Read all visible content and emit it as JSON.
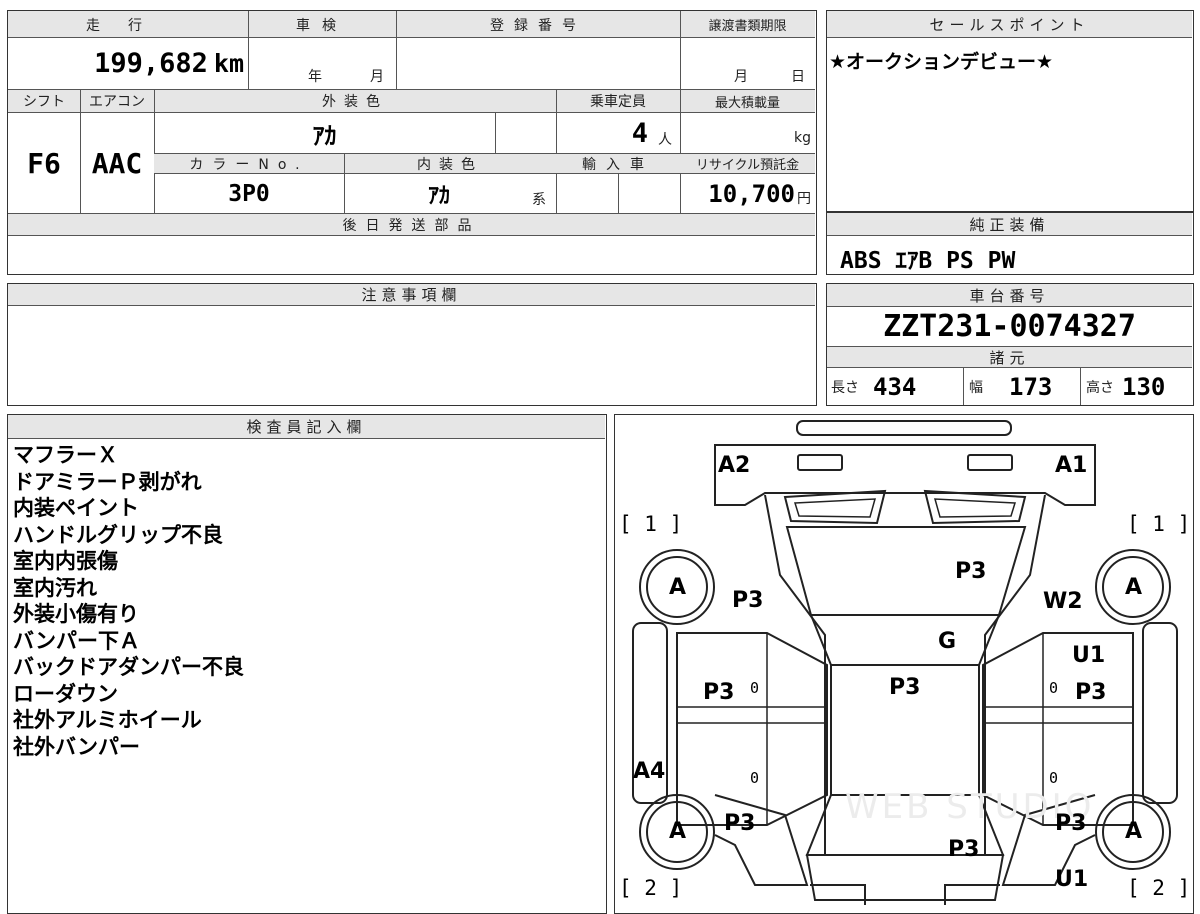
{
  "top_form": {
    "mileage": {
      "label": "走行",
      "value": "199,682",
      "unit": "km"
    },
    "shaken": {
      "label": "車検",
      "year_unit": "年",
      "month_unit": "月"
    },
    "registration_number": {
      "label": "登録番号",
      "value": ""
    },
    "transfer_deadline": {
      "label": "譲渡書類期限",
      "month_unit": "月",
      "day_unit": "日"
    },
    "shift": {
      "label": "シフト",
      "value": "F6"
    },
    "aircon": {
      "label": "エアコン",
      "value": "AAC"
    },
    "exterior_color": {
      "label": "外装色",
      "value": "ｱｶ"
    },
    "capacity": {
      "label": "乗車定員",
      "value": "4",
      "unit": "人"
    },
    "max_load": {
      "label": "最大積載量",
      "unit": "kg"
    },
    "color_no": {
      "label": "カラーNo.",
      "value": "3P0"
    },
    "interior_color": {
      "label": "内装色",
      "value": "ｱｶ",
      "suffix": "系"
    },
    "import": {
      "label": "輸入車"
    },
    "recycle_fee": {
      "label": "リサイクル預託金",
      "value": "10,700",
      "unit": "円"
    },
    "later_parts": {
      "label": "後日発送部品"
    }
  },
  "sales_point": {
    "label": "セールスポイント",
    "text": "★オークションデビュー★"
  },
  "equipment": {
    "label": "純正装備",
    "text": "ABS ｴｱB PS PW"
  },
  "notes": {
    "label": "注意事項欄"
  },
  "chassis": {
    "label": "車台番号",
    "value": "ZZT231-0074327"
  },
  "specs": {
    "label": "諸元",
    "length_label": "長さ",
    "length": "434",
    "width_label": "幅",
    "width": "173",
    "height_label": "高さ",
    "height": "130"
  },
  "inspector": {
    "label": "検査員記入欄",
    "lines": [
      "マフラーＸ",
      "ドアミラーＰ剥がれ",
      "内装ペイント",
      "ハンドルグリップ不良",
      "室内内張傷",
      "室内汚れ",
      "外装小傷有り",
      "バンパー下Ａ",
      "バックドアダンパー不良",
      "ローダウン",
      "社外アルミホイール",
      "社外バンパー"
    ]
  },
  "diagram": {
    "marks": {
      "a2": "A2",
      "a1": "A1",
      "bracket_tl": "[ 1 ]",
      "bracket_tr": "[ 1 ]",
      "bracket_bl": "[ 2 ]",
      "bracket_br": "[ 2 ]",
      "wheel_a": "A",
      "p3": "P3",
      "w2": "W2",
      "g": "G",
      "u1": "U1",
      "a4": "A4",
      "zero": "0"
    },
    "watermark": "WEB STUDIO"
  }
}
